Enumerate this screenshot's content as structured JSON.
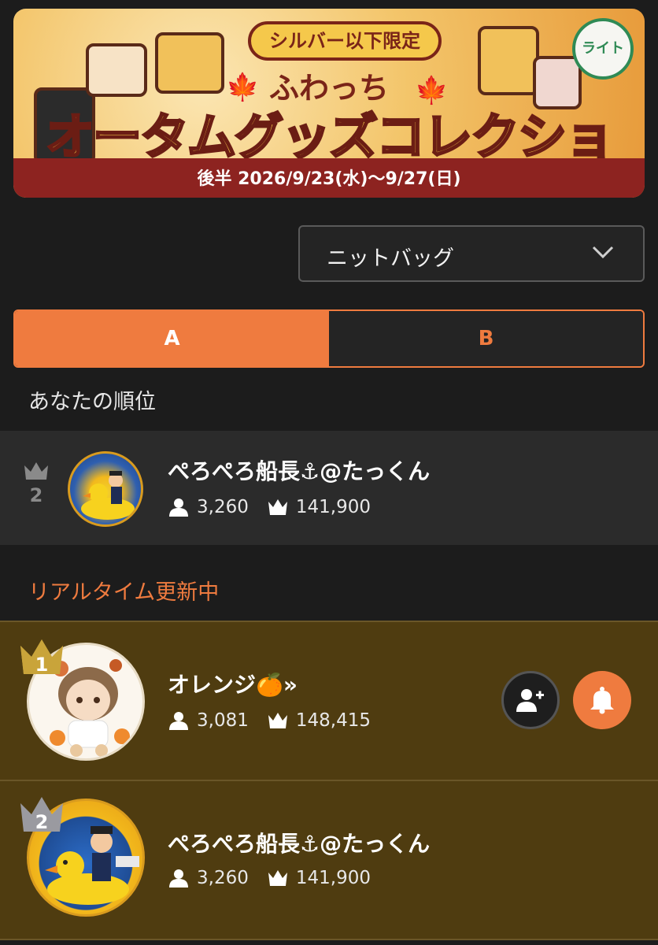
{
  "banner": {
    "badge": "シルバー以下限定",
    "subtitle": "ふわっち",
    "title": "オータムグッズコレクション",
    "dates": "後半 2026/9/23(水)〜9/27(日)",
    "stamp": "ライト"
  },
  "dropdown": {
    "selected": "ニットバッグ"
  },
  "tabs": [
    {
      "label": "A",
      "active": true
    },
    {
      "label": "B",
      "active": false
    }
  ],
  "my_rank": {
    "section_label": "あなたの順位",
    "rank": "2",
    "name": "ぺろぺろ船長⚓@たっくん",
    "followers": "3,260",
    "points": "141,900"
  },
  "realtime": {
    "section_label": "リアルタイム更新中",
    "rows": [
      {
        "rank": "1",
        "name": "オレンジ🍊»",
        "followers": "3,081",
        "points": "148,415"
      },
      {
        "rank": "2",
        "name": "ぺろぺろ船長⚓@たっくん",
        "followers": "3,260",
        "points": "141,900"
      }
    ]
  },
  "colors": {
    "accent": "#ef7b3f",
    "row_bg": "#4f3c10",
    "gold_crown": "#c9a43a",
    "silver_crown": "#9a9aa0"
  }
}
